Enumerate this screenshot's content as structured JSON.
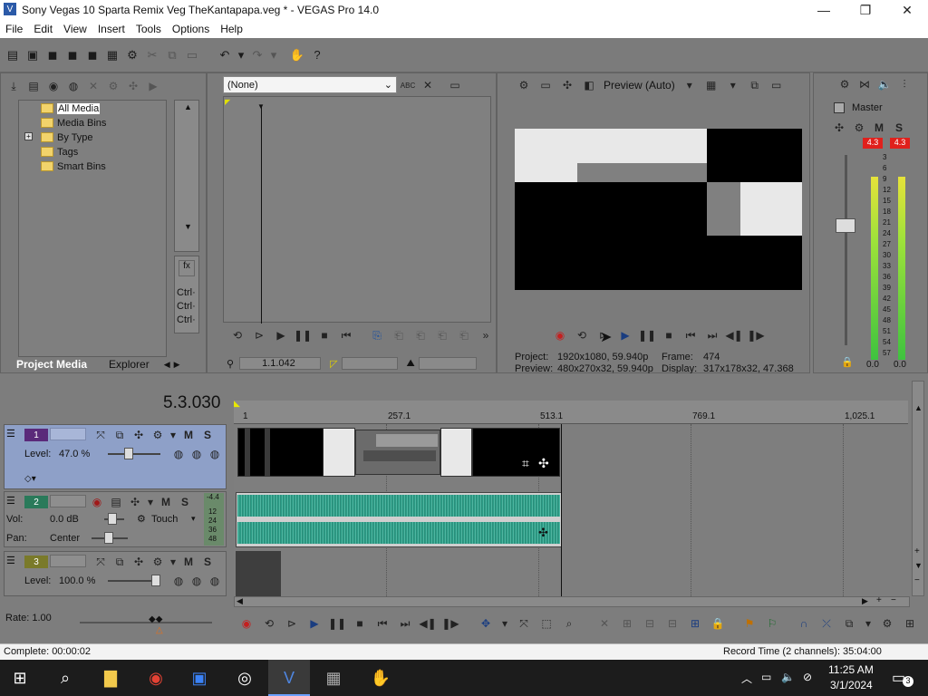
{
  "window": {
    "title": "Sony Vegas 10 Sparta Remix Veg TheKantapapa.veg * - VEGAS Pro 14.0"
  },
  "menu": [
    "File",
    "Edit",
    "View",
    "Insert",
    "Tools",
    "Options",
    "Help"
  ],
  "project_media": {
    "tree": [
      "All Media",
      "Media Bins",
      "By Type",
      "Tags",
      "Smart Bins"
    ],
    "tabs": [
      "Project Media",
      "Explorer"
    ],
    "ctrl_labels": [
      "Ctrl·",
      "Ctrl·",
      "Ctrl·"
    ]
  },
  "trimmer": {
    "dropdown": "(None)",
    "timecode": "1.1.042"
  },
  "preview": {
    "mode": "Preview (Auto)",
    "project_label": "Project:",
    "project_value": "1920x1080, 59.940p",
    "preview_label": "Preview:",
    "preview_value": "480x270x32, 59.940p",
    "frame_label": "Frame:",
    "frame_value": "474",
    "display_label": "Display:",
    "display_value": "317x178x32, 47.368"
  },
  "master": {
    "label": "Master",
    "peak_left": "4.3",
    "peak_right": "4.3",
    "scale": [
      "3",
      "6",
      "9",
      "12",
      "15",
      "18",
      "21",
      "24",
      "27",
      "30",
      "33",
      "36",
      "39",
      "42",
      "45",
      "48",
      "51",
      "54",
      "57"
    ],
    "bottom_left": "0.0",
    "bottom_right": "0.0"
  },
  "timeline": {
    "cursor_time": "5.3.030",
    "ruler": [
      "1",
      "257.1",
      "513.1",
      "769.1",
      "1,025.1"
    ],
    "tracks": [
      {
        "num": "1",
        "level_label": "Level:",
        "level_value": "47.0 %",
        "m": "M",
        "s": "S"
      },
      {
        "num": "2",
        "vol_label": "Vol:",
        "vol_value": "0.0 dB",
        "pan_label": "Pan:",
        "pan_value": "Center",
        "mode": "Touch",
        "m": "M",
        "s": "S",
        "meter_top": "-4.4",
        "meter_vals": [
          "12",
          "24",
          "36",
          "48"
        ]
      },
      {
        "num": "3",
        "level_label": "Level:",
        "level_value": "100.0 %",
        "m": "M",
        "s": "S"
      }
    ],
    "rate": "Rate: 1.00"
  },
  "status": {
    "left": "Complete: 00:00:02",
    "right": "Record Time (2 channels): 35:04:00"
  },
  "taskbar": {
    "time": "11:25 AM",
    "date": "3/1/2024",
    "notif_count": "3"
  },
  "colors": {
    "accent": "#3d6fbf",
    "clip_bg": "#e8e8e8",
    "wave": "#2c9c86",
    "peak": "#e0201c"
  }
}
